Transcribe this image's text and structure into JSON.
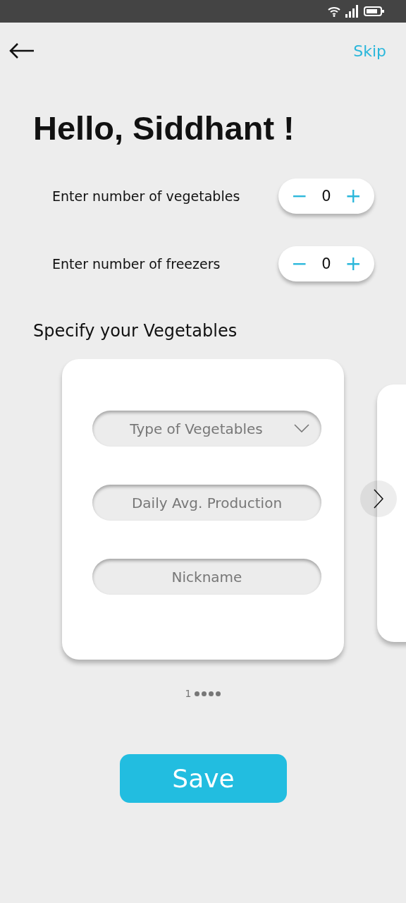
{
  "header": {
    "skip": "Skip"
  },
  "greeting": "Hello, Siddhant !",
  "counters": [
    {
      "label": "Enter number of vegetables",
      "minus": "−",
      "value": "0",
      "plus": "+"
    },
    {
      "label": "Enter number of freezers",
      "minus": "−",
      "value": "0",
      "plus": "+"
    }
  ],
  "section_title": "Specify your Vegetables",
  "card": {
    "fields": [
      {
        "kind": "dropdown",
        "placeholder": "Type of Vegetables"
      },
      {
        "kind": "text",
        "placeholder": "Daily Avg. Production"
      },
      {
        "kind": "text",
        "placeholder": "Nickname"
      }
    ]
  },
  "pagination": [
    {
      "label": "1",
      "selected": true
    },
    {
      "selected": false
    },
    {
      "selected": false
    },
    {
      "selected": false
    },
    {
      "selected": false
    }
  ],
  "save_button": "Save"
}
